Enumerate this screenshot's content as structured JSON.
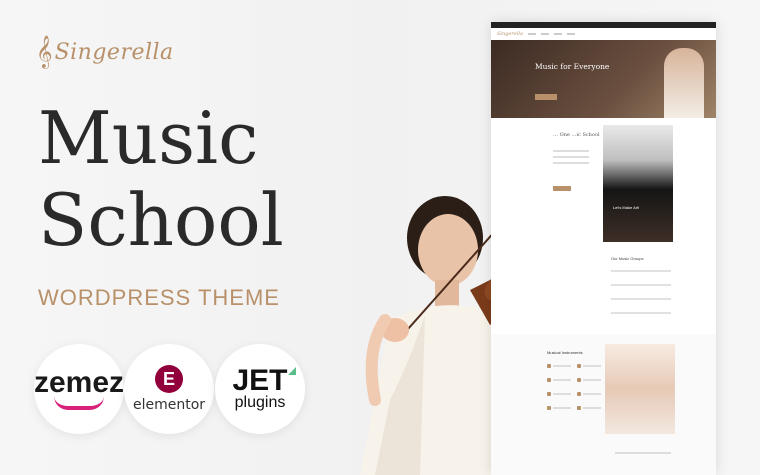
{
  "brand": {
    "logo_mark": "𝄞",
    "logo_text": "Singerella",
    "accent_color": "#b8916a"
  },
  "headline": {
    "line1": "Music",
    "line2": "School",
    "subtitle": "WORDPRESS THEME"
  },
  "badges": [
    {
      "name": "zemez",
      "text": "zemez",
      "swoosh_color": "#d9217a"
    },
    {
      "name": "elementor",
      "text": "elementor",
      "icon_letter": "E",
      "icon_color": "#92003b"
    },
    {
      "name": "jet",
      "text": "JET",
      "subtext": "plugins",
      "accent": "#5bbd8a"
    }
  ],
  "preview": {
    "hero_title": "Music for Everyone",
    "hero_subtitle": "",
    "about_title": "… One\n…ic School",
    "piano_label": "Let's Make Art!",
    "groups_title": "Our Music Groups",
    "instruments_title": "Musical Instruments"
  }
}
